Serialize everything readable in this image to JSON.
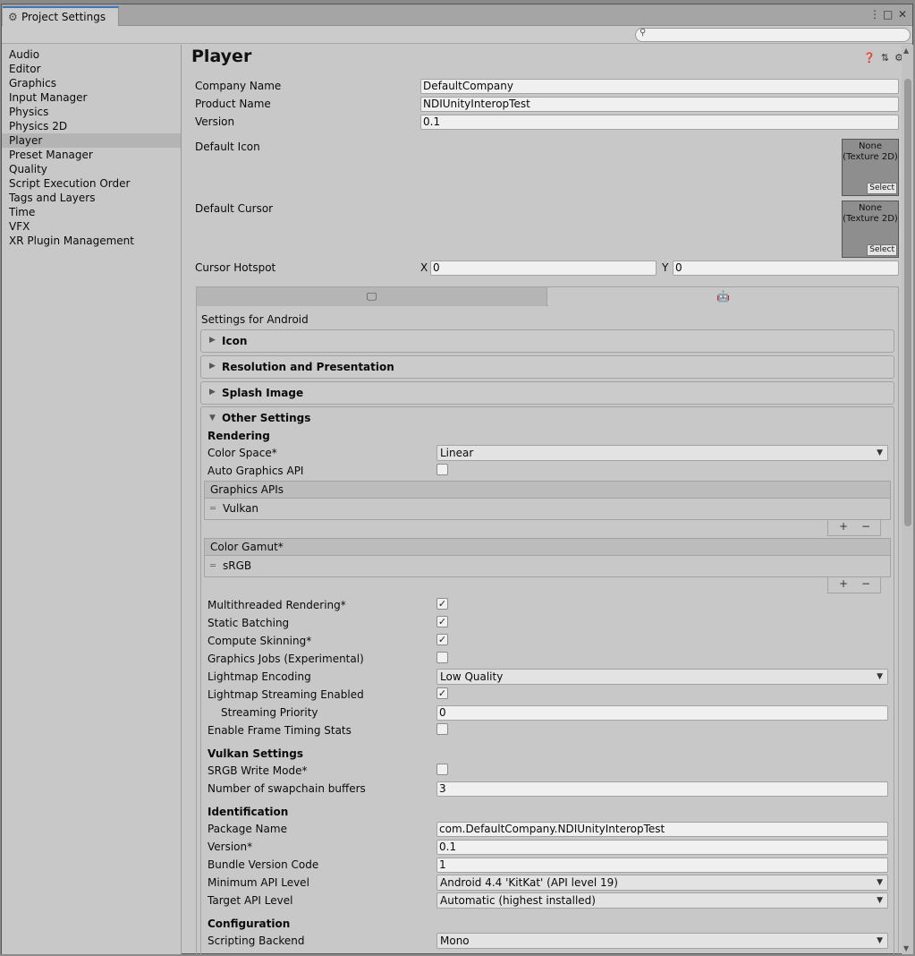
{
  "window": {
    "tab_title": "Project Settings",
    "tab_icon": "gear-icon",
    "controls": [
      "⋮",
      "□",
      "✕"
    ]
  },
  "search": {
    "placeholder": "",
    "icon": "search-icon"
  },
  "sidebar": {
    "items": [
      {
        "label": "Audio"
      },
      {
        "label": "Editor"
      },
      {
        "label": "Graphics"
      },
      {
        "label": "Input Manager"
      },
      {
        "label": "Physics"
      },
      {
        "label": "Physics 2D"
      },
      {
        "label": "Player"
      },
      {
        "label": "Preset Manager"
      },
      {
        "label": "Quality"
      },
      {
        "label": "Script Execution Order"
      },
      {
        "label": "Tags and Layers"
      },
      {
        "label": "Time"
      },
      {
        "label": "VFX"
      },
      {
        "label": "XR Plugin Management"
      }
    ],
    "selected": "Player"
  },
  "main": {
    "title": "Player",
    "header_icons": [
      "help-icon",
      "preset-icon",
      "settings-icon"
    ],
    "company_name": {
      "label": "Company Name",
      "value": "DefaultCompany"
    },
    "product_name": {
      "label": "Product Name",
      "value": "NDIUnityInteropTest"
    },
    "version": {
      "label": "Version",
      "value": "0.1"
    },
    "default_icon": {
      "label": "Default Icon",
      "tex_none": "None",
      "tex_type": "(Texture 2D)",
      "select": "Select"
    },
    "default_cursor": {
      "label": "Default Cursor",
      "tex_none": "None",
      "tex_type": "(Texture 2D)",
      "select": "Select"
    },
    "cursor_hotspot": {
      "label": "Cursor Hotspot",
      "x_label": "X",
      "x_value": "0",
      "y_label": "Y",
      "y_value": "0"
    },
    "platform_tabs": [
      {
        "icon": "desktop-icon",
        "active": false
      },
      {
        "icon": "android-icon",
        "active": true
      }
    ],
    "settings_for": "Settings for Android",
    "foldouts": {
      "icon": "Icon",
      "resolution": "Resolution and Presentation",
      "splash": "Splash Image",
      "other": "Other Settings"
    },
    "rendering": {
      "heading": "Rendering",
      "color_space": {
        "label": "Color Space*",
        "value": "Linear"
      },
      "auto_graphics_api": {
        "label": "Auto Graphics API",
        "checked": false
      },
      "graphics_apis": {
        "header": "Graphics APIs",
        "item": "Vulkan"
      },
      "color_gamut": {
        "header": "Color Gamut*",
        "item": "sRGB"
      },
      "multithreaded": {
        "label": "Multithreaded Rendering*",
        "checked": true
      },
      "static_batching": {
        "label": "Static Batching",
        "checked": true
      },
      "compute_skinning": {
        "label": "Compute Skinning*",
        "checked": true
      },
      "graphics_jobs": {
        "label": "Graphics Jobs (Experimental)",
        "checked": false
      },
      "lightmap_encoding": {
        "label": "Lightmap Encoding",
        "value": "Low Quality"
      },
      "lightmap_streaming": {
        "label": "Lightmap Streaming Enabled",
        "checked": true
      },
      "streaming_priority": {
        "label": "Streaming Priority",
        "value": "0"
      },
      "frame_timing": {
        "label": "Enable Frame Timing Stats",
        "checked": false
      }
    },
    "vulkan": {
      "heading": "Vulkan Settings",
      "srgb_write": {
        "label": "SRGB Write Mode*",
        "checked": false
      },
      "swapchain": {
        "label": "Number of swapchain buffers",
        "value": "3"
      }
    },
    "identification": {
      "heading": "Identification",
      "package_name": {
        "label": "Package Name",
        "value": "com.DefaultCompany.NDIUnityInteropTest"
      },
      "version": {
        "label": "Version*",
        "value": "0.1"
      },
      "bundle_code": {
        "label": "Bundle Version Code",
        "value": "1"
      },
      "min_api": {
        "label": "Minimum API Level",
        "value": "Android 4.4 'KitKat' (API level 19)"
      },
      "target_api": {
        "label": "Target API Level",
        "value": "Automatic (highest installed)"
      }
    },
    "configuration": {
      "heading": "Configuration",
      "scripting_backend": {
        "label": "Scripting Backend",
        "value": "Mono"
      }
    }
  },
  "colors": {
    "accent": "#3a79bb",
    "panel": "#c8c8c8",
    "selected": "#b4b4b4"
  }
}
